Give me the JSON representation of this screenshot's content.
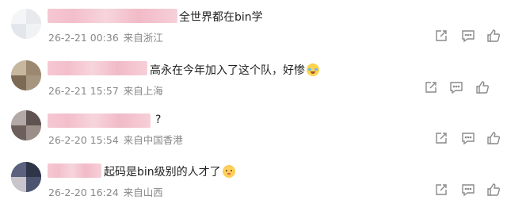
{
  "comments": [
    {
      "text": "全世界都在bin学",
      "time": "26-2-21 00:36",
      "location": "来自浙江",
      "emoji": ""
    },
    {
      "text": "高永在今年加入了这个队，好惨",
      "time": "26-2-21 15:57",
      "location": "来自上海",
      "emoji": "laugh-cry"
    },
    {
      "text": "?",
      "time": "26-2-20 15:54",
      "location": "来自中国香港",
      "emoji": ""
    },
    {
      "text": "起码是bin级别的人才了",
      "time": "26-2-20 16:24",
      "location": "来自山西",
      "emoji": "cat"
    }
  ],
  "icons": [
    "share-icon",
    "comment-icon",
    "like-icon"
  ],
  "colors": {
    "meta_text": "#888888",
    "icon_stroke": "#8a8a8a",
    "blurred_name": "#f2b8c6"
  }
}
